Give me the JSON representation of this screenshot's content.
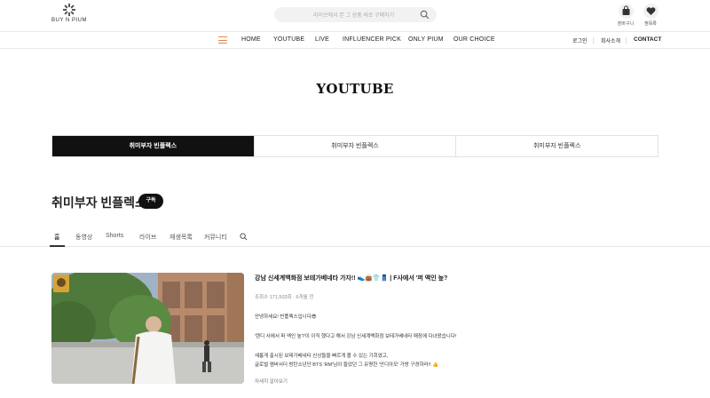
{
  "brand": {
    "name": "BUY N PIUM"
  },
  "search": {
    "placeholder": "라이브에서 본 그 상품 바로 구매하기"
  },
  "header_icons": [
    {
      "label": "장바구니",
      "icon": "shopping-bag-icon"
    },
    {
      "label": "찜목록",
      "icon": "heart-icon"
    }
  ],
  "nav": {
    "items": [
      "HOME",
      "YOUTUBE",
      "LIVE",
      "INFLUENCER PICK",
      "ONLY PIUM",
      "OUR CHOICE"
    ],
    "utility": [
      "로그인",
      "회사소개",
      "CONTACT"
    ]
  },
  "page": {
    "title": "YOUTUBE"
  },
  "influencer_tabs": [
    "취미부자 빈플렉스",
    "취미부자 빈플렉스",
    "취미부자 빈플렉스"
  ],
  "channel": {
    "name": "취미부자 빈플렉스",
    "subscribe_label": "구독",
    "tabs": [
      "홈",
      "동영상",
      "Shorts",
      "라이브",
      "재생목록",
      "커뮤니티"
    ]
  },
  "video": {
    "title": "강남 신세계백화점 보테가베네타 가자!! 👟👜👕👖 | F사에서 '퍼 액인 높?",
    "meta": "조회수 171,503회 · 6개월 전",
    "description": [
      "안녕하세요! 빈플렉스입니다😎",
      "'렌디 사에서 퍼 액인 높?'이 이직 했다고 해서 강남 신세계백화점 보테가베네타 매장에 다녀왔습니다!",
      "새롭게 출시된 보테가베네타 신상들을 빠르게 볼 수 있는 기회였고,",
      "글로벌 앰버서더 방탄소년단 BTS 'RM'님이 들었던 그 유명한 '안디아모' 가방 구경하러!! 👍"
    ],
    "more_label": "자세히 알아보기"
  },
  "colors": {
    "accent": "#e08a4a",
    "active_tab": "#111111"
  }
}
